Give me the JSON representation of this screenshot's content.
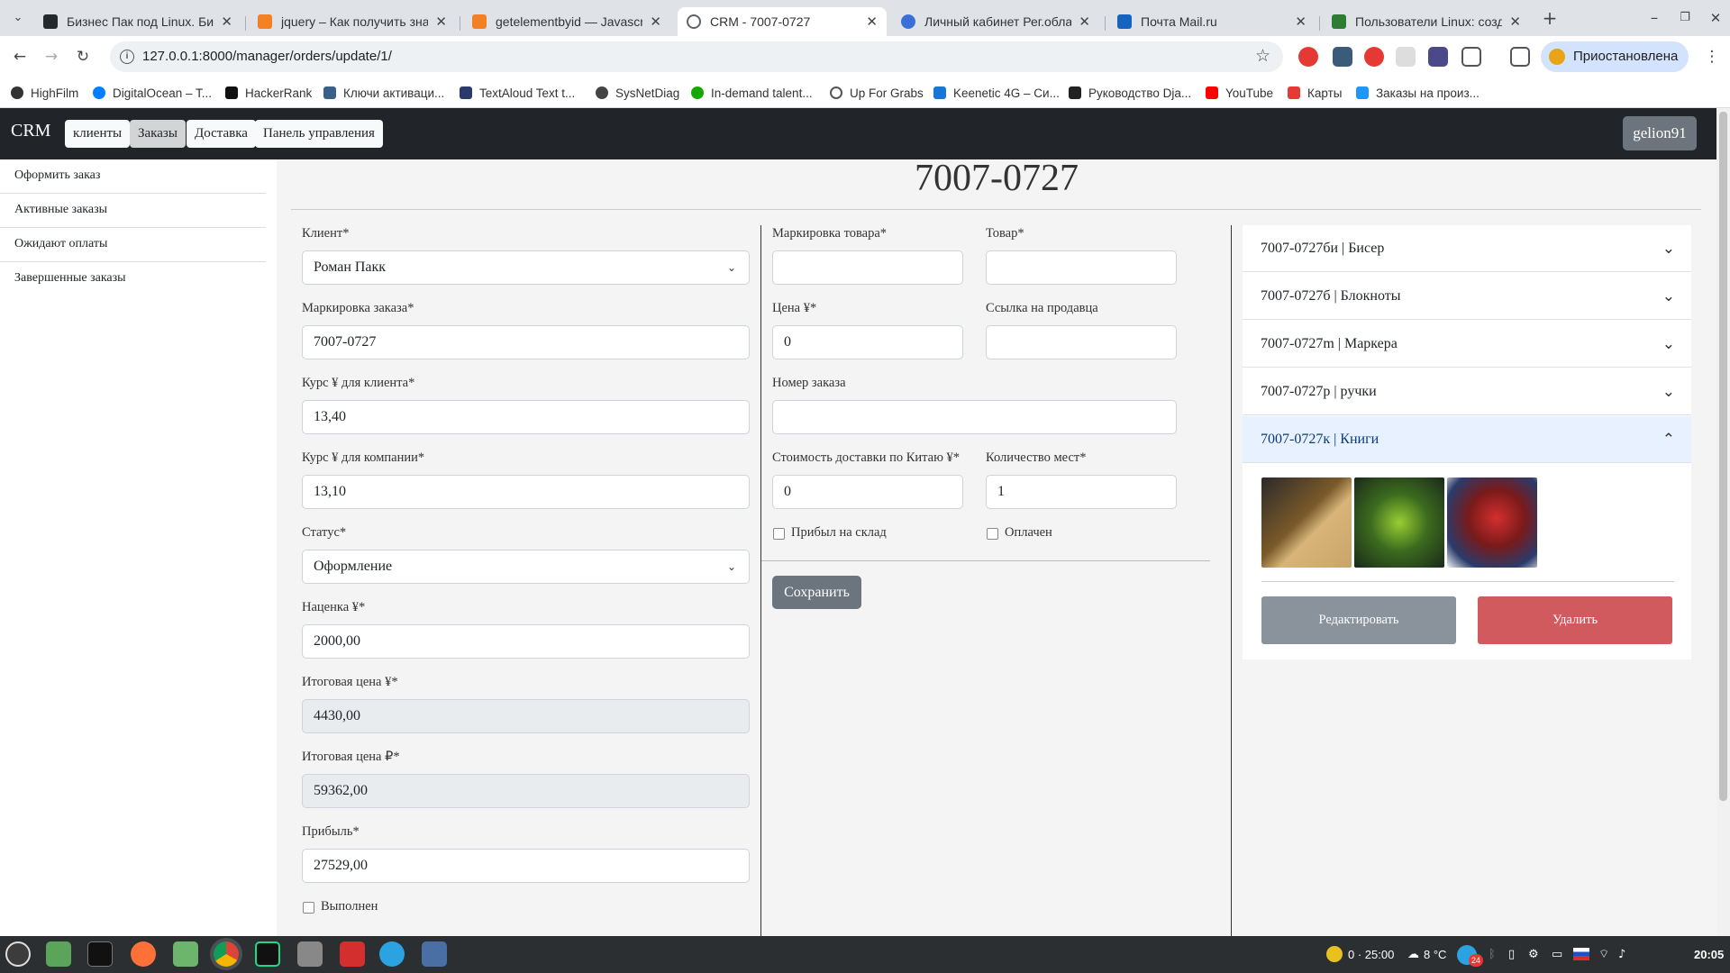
{
  "browser": {
    "tabs": [
      {
        "title": "Бизнес Пак под Linux. Бизнес",
        "color": "#2b6b2b"
      },
      {
        "title": "jquery – Как получить знач",
        "color": "#f48024"
      },
      {
        "title": "getelementbyid — Javascript",
        "color": "#f48024"
      },
      {
        "title": "CRM - 7007-0727",
        "color": "#5f6368"
      },
      {
        "title": "Личный кабинет Рег.облак",
        "color": "#3b6fd8"
      },
      {
        "title": "Почта Mail.ru",
        "color": "#1565c0"
      },
      {
        "title": "Пользователи Linux: создан",
        "color": "#2e7d32"
      }
    ],
    "url": "127.0.0.1:8000/manager/orders/update/1/",
    "profile": "Приостановлена",
    "bookmarks": [
      "HighFilm",
      "DigitalOcean – T...",
      "HackerRank",
      "Ключи активаци...",
      "TextAloud Text t...",
      "SysNetDiag",
      "In-demand talent...",
      "Up For Grabs",
      "Keenetic 4G – Си...",
      "Руководство Dja...",
      "YouTube",
      "Карты",
      "Заказы на произ..."
    ]
  },
  "navbar": {
    "brand": "CRM",
    "items": [
      "клиенты",
      "Заказы",
      "Доставка",
      "Панель управления"
    ],
    "user": "gelion91"
  },
  "sidebar": [
    "Оформить заказ",
    "Активные заказы",
    "Ожидают оплаты",
    "Завершенные заказы"
  ],
  "page_title": "7007-0727",
  "form": {
    "client_label": "Клиент*",
    "client": "Роман Пакк",
    "order_mark_label": "Маркировка заказа*",
    "order_mark": "7007-0727",
    "rate_client_label": "Курс ¥ для клиента*",
    "rate_client": "13,40",
    "rate_company_label": "Курс ¥ для компании*",
    "rate_company": "13,10",
    "status_label": "Статус*",
    "status": "Оформление",
    "markup_label": "Наценка ¥*",
    "markup": "2000,00",
    "total_cny_label": "Итоговая цена ¥*",
    "total_cny": "4430,00",
    "total_rub_label": "Итоговая цена ₽*",
    "total_rub": "59362,00",
    "profit_label": "Прибыль*",
    "profit": "27529,00",
    "done_label": "Выполнен"
  },
  "item_form": {
    "item_mark_label": "Маркировка товара*",
    "item_mark": "",
    "item_label": "Товар*",
    "item": "",
    "price_label": "Цена ¥*",
    "price": "0",
    "seller_link_label": "Ссылка на продавца",
    "seller_link": "",
    "order_no_label": "Номер заказа",
    "order_no": "",
    "china_delivery_label": "Стоимость доставки по Китаю ¥*",
    "china_delivery": "0",
    "places_label": "Количество мест*",
    "places": "1",
    "arrived_label": "Прибыл на склад",
    "paid_label": "Оплачен",
    "save": "Сохранить"
  },
  "accordion": [
    {
      "label": "7007-0727би | Бисер",
      "open": false
    },
    {
      "label": "7007-0727б | Блокноты",
      "open": false
    },
    {
      "label": "7007-0727m | Маркера",
      "open": false
    },
    {
      "label": "7007-0727р | ручки",
      "open": false
    },
    {
      "label": "7007-0727к | Книги",
      "open": true
    }
  ],
  "accordion_actions": {
    "edit": "Редактировать",
    "delete": "Удалить"
  },
  "taskbar": {
    "weather_a": "0 · 25:00",
    "weather_b": "8 °C",
    "badge": "24",
    "time": "20:05"
  }
}
